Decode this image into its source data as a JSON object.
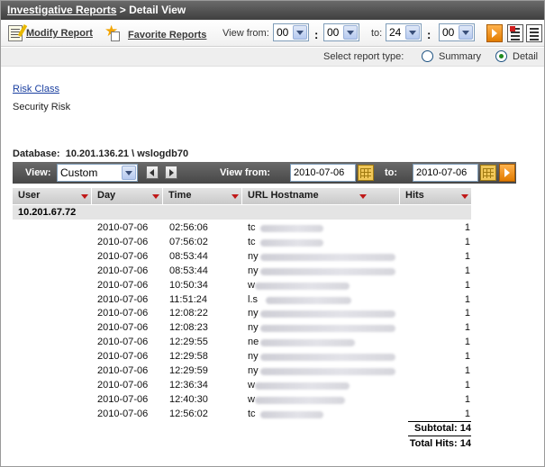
{
  "header": {
    "breadcrumb_link": "Investigative Reports",
    "breadcrumb_sep": " > ",
    "breadcrumb_current": "Detail View"
  },
  "toolbar": {
    "modify_report": "Modify Report",
    "favorite_reports": "Favorite Reports",
    "view_from_label": "View from:",
    "from_hour": "00",
    "from_minute": "00",
    "to_label": "to:",
    "to_hour": "24",
    "to_minute": "00"
  },
  "report_type": {
    "label": "Select report type:",
    "options": [
      "Summary",
      "Detail"
    ],
    "selected": "Detail"
  },
  "risk": {
    "link": "Risk Class",
    "value": "Security Risk"
  },
  "database": {
    "label": "Database:",
    "value": "10.201.136.21 \\ wslogdb70"
  },
  "report_bar": {
    "view_label": "View:",
    "view_value": "Custom",
    "view_from_label": "View from:",
    "from_date": "2010-07-06",
    "to_label": "to:",
    "to_date": "2010-07-06"
  },
  "table": {
    "columns": [
      "User",
      "Day",
      "Time",
      "URL Hostname",
      "Hits"
    ],
    "group": "10.201.67.72",
    "rows": [
      {
        "day": "2010-07-06",
        "time": "02:56:06",
        "host_prefix": "tc",
        "hits": "1"
      },
      {
        "day": "2010-07-06",
        "time": "07:56:02",
        "host_prefix": "tc",
        "hits": "1"
      },
      {
        "day": "2010-07-06",
        "time": "08:53:44",
        "host_prefix": "ny",
        "hits": "1"
      },
      {
        "day": "2010-07-06",
        "time": "08:53:44",
        "host_prefix": "ny",
        "hits": "1"
      },
      {
        "day": "2010-07-06",
        "time": "10:50:34",
        "host_prefix": "w",
        "hits": "1"
      },
      {
        "day": "2010-07-06",
        "time": "11:51:24",
        "host_prefix": "l.s",
        "hits": "1"
      },
      {
        "day": "2010-07-06",
        "time": "12:08:22",
        "host_prefix": "ny",
        "hits": "1"
      },
      {
        "day": "2010-07-06",
        "time": "12:08:23",
        "host_prefix": "ny",
        "hits": "1"
      },
      {
        "day": "2010-07-06",
        "time": "12:29:55",
        "host_prefix": "ne",
        "hits": "1"
      },
      {
        "day": "2010-07-06",
        "time": "12:29:58",
        "host_prefix": "ny",
        "hits": "1"
      },
      {
        "day": "2010-07-06",
        "time": "12:29:59",
        "host_prefix": "ny",
        "hits": "1"
      },
      {
        "day": "2010-07-06",
        "time": "12:36:34",
        "host_prefix": "w",
        "hits": "1"
      },
      {
        "day": "2010-07-06",
        "time": "12:40:30",
        "host_prefix": "w",
        "hits": "1"
      },
      {
        "day": "2010-07-06",
        "time": "12:56:02",
        "host_prefix": "tc",
        "hits": "1"
      }
    ],
    "subtotal": "Subtotal: 14",
    "total": "Total Hits: 14"
  },
  "colors": {
    "header_bg": "#474747",
    "link_blue": "#1a3fa0",
    "accent_orange": "#e27b00",
    "sort_arrow": "#c01818"
  }
}
